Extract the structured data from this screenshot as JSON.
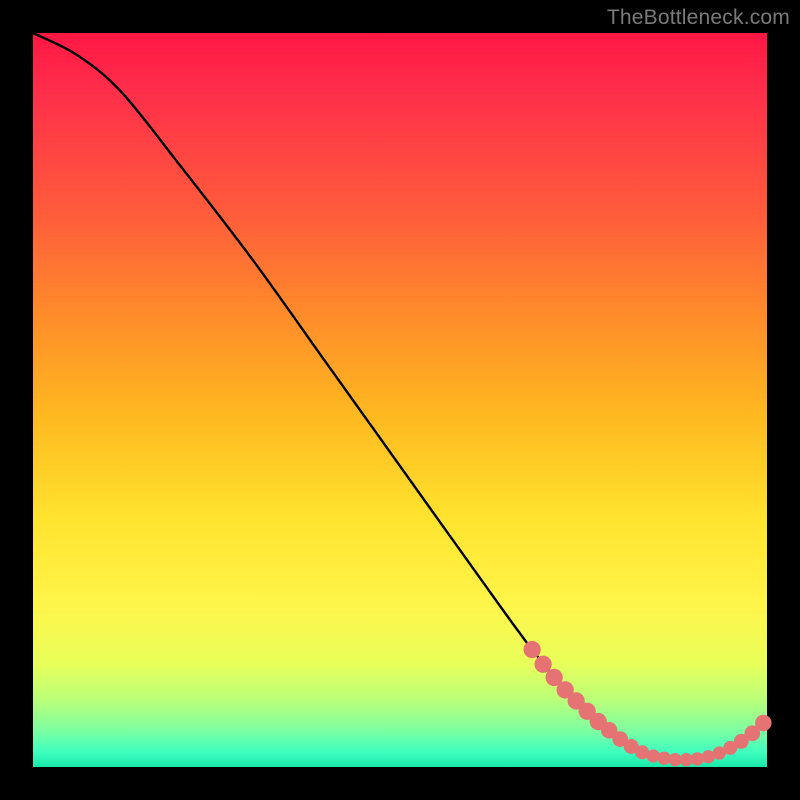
{
  "watermark": "TheBottleneck.com",
  "chart_data": {
    "type": "line",
    "title": "",
    "xlabel": "",
    "ylabel": "",
    "xlim": [
      0,
      100
    ],
    "ylim": [
      0,
      100
    ],
    "curve": [
      {
        "x": 0,
        "y": 100
      },
      {
        "x": 6,
        "y": 97
      },
      {
        "x": 12,
        "y": 92
      },
      {
        "x": 20,
        "y": 82
      },
      {
        "x": 30,
        "y": 69
      },
      {
        "x": 40,
        "y": 55
      },
      {
        "x": 50,
        "y": 41
      },
      {
        "x": 60,
        "y": 27
      },
      {
        "x": 68,
        "y": 16
      },
      {
        "x": 74,
        "y": 9
      },
      {
        "x": 80,
        "y": 3.5
      },
      {
        "x": 85,
        "y": 1.2
      },
      {
        "x": 90,
        "y": 1.0
      },
      {
        "x": 94,
        "y": 2.2
      },
      {
        "x": 97,
        "y": 4.0
      },
      {
        "x": 100,
        "y": 6.5
      }
    ],
    "markers": [
      {
        "x": 68,
        "y": 16,
        "r": 1.4
      },
      {
        "x": 69.5,
        "y": 14,
        "r": 1.4
      },
      {
        "x": 71,
        "y": 12.2,
        "r": 1.4
      },
      {
        "x": 72.5,
        "y": 10.5,
        "r": 1.4
      },
      {
        "x": 74,
        "y": 9,
        "r": 1.4
      },
      {
        "x": 75.5,
        "y": 7.6,
        "r": 1.4
      },
      {
        "x": 77,
        "y": 6.2,
        "r": 1.4
      },
      {
        "x": 78.5,
        "y": 5,
        "r": 1.3
      },
      {
        "x": 80,
        "y": 3.8,
        "r": 1.2
      },
      {
        "x": 81.5,
        "y": 2.8,
        "r": 1.1
      },
      {
        "x": 83,
        "y": 2.0,
        "r": 1.0
      },
      {
        "x": 84.5,
        "y": 1.5,
        "r": 0.9
      },
      {
        "x": 86,
        "y": 1.2,
        "r": 0.9
      },
      {
        "x": 87.5,
        "y": 1.0,
        "r": 0.9
      },
      {
        "x": 89,
        "y": 1.0,
        "r": 0.9
      },
      {
        "x": 90.5,
        "y": 1.1,
        "r": 0.9
      },
      {
        "x": 92,
        "y": 1.4,
        "r": 0.9
      },
      {
        "x": 93.5,
        "y": 1.9,
        "r": 0.9
      },
      {
        "x": 95,
        "y": 2.6,
        "r": 1.0
      },
      {
        "x": 96.5,
        "y": 3.5,
        "r": 1.1
      },
      {
        "x": 98,
        "y": 4.6,
        "r": 1.2
      },
      {
        "x": 99.5,
        "y": 6.0,
        "r": 1.3
      }
    ],
    "colors": {
      "curve": "#000000",
      "marker": "#e57373"
    }
  }
}
